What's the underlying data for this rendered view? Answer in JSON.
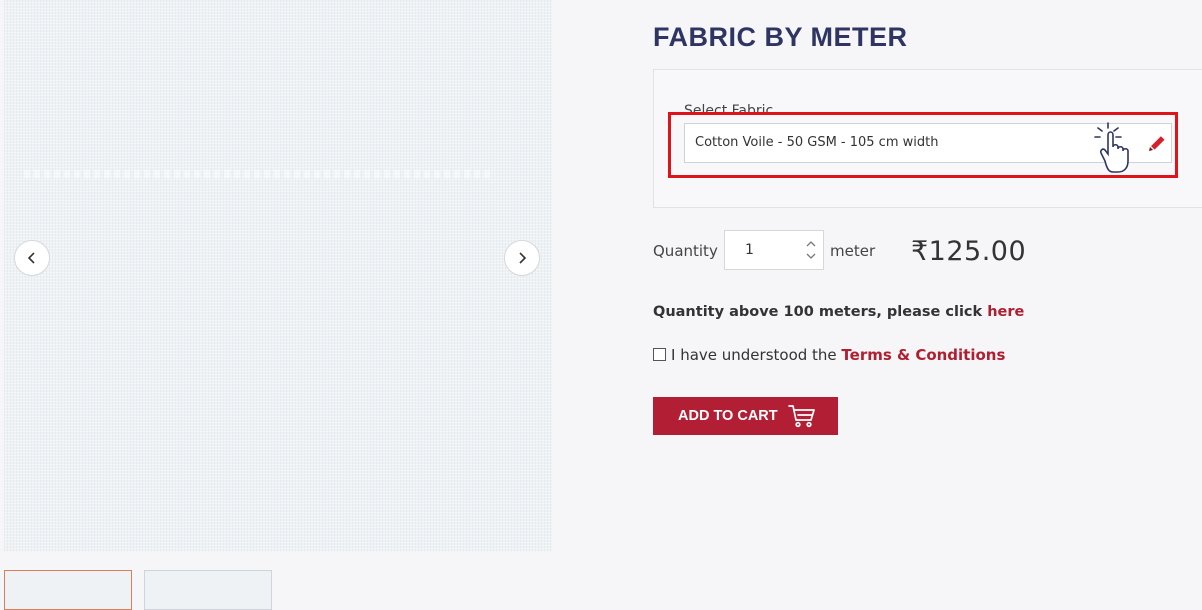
{
  "product": {
    "title": "FABRIC BY METER"
  },
  "fabric_select": {
    "label": "Select Fabric",
    "value": "Cotton Voile - 50 GSM - 105 cm width"
  },
  "quantity": {
    "label": "Quantity",
    "value": "1",
    "unit": "meter"
  },
  "price": "₹125.00",
  "bulk_note": {
    "text": "Quantity above 100 meters, please click ",
    "link": "here"
  },
  "terms": {
    "text": "I have understood the ",
    "link": "Terms & Conditions",
    "checked": false
  },
  "cart": {
    "label": "ADD TO CART"
  },
  "colors": {
    "title": "#2e3563",
    "accent": "#b21f34",
    "highlight": "#e0131b",
    "link": "#b01f2f"
  },
  "icons": {
    "prev": "chevron-left-icon",
    "next": "chevron-right-icon",
    "pointer": "hand-pointer-icon",
    "edit": "pencil-icon",
    "cart": "cart-icon"
  }
}
